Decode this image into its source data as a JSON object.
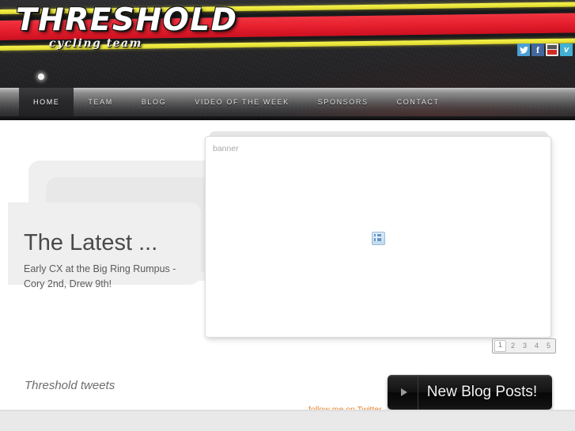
{
  "site": {
    "logo_main": "THRESHOLD",
    "logo_sub": "cycling team"
  },
  "colors": {
    "stripe_yellow": "#ece83c",
    "stripe_red": "#e8212f",
    "header_dark": "#272729",
    "accent_orange": "#e8832a",
    "nav_active": "#2a2a2c"
  },
  "social": [
    {
      "name": "twitter-icon",
      "glyph": "ᵕ",
      "label": "Twitter"
    },
    {
      "name": "facebook-icon",
      "glyph": "f",
      "label": "Facebook"
    },
    {
      "name": "youtube-icon",
      "glyph": "",
      "label": "YouTube"
    },
    {
      "name": "vimeo-icon",
      "glyph": "v",
      "label": "Vimeo"
    }
  ],
  "nav": {
    "items": [
      {
        "label": "HOME",
        "active": true
      },
      {
        "label": "TEAM",
        "active": false
      },
      {
        "label": "BLOG",
        "active": false
      },
      {
        "label": "VIDEO OF THE WEEK",
        "active": false
      },
      {
        "label": "SPONSORS",
        "active": false
      },
      {
        "label": "CONTACT",
        "active": false
      }
    ]
  },
  "latest": {
    "title": "The Latest ...",
    "text": "Early CX at the Big Ring Rumpus - Cory 2nd, Drew 9th!"
  },
  "banner": {
    "label": "banner",
    "placeholder_icon": "broken-image-icon"
  },
  "pagination": {
    "pages": [
      "1",
      "2",
      "3",
      "4",
      "5"
    ],
    "current": "1"
  },
  "tweets": {
    "title": "Threshold tweets",
    "follow_link": "follow me on Twitter"
  },
  "blog_button": {
    "label": "New Blog Posts!",
    "icon": "play-icon"
  }
}
